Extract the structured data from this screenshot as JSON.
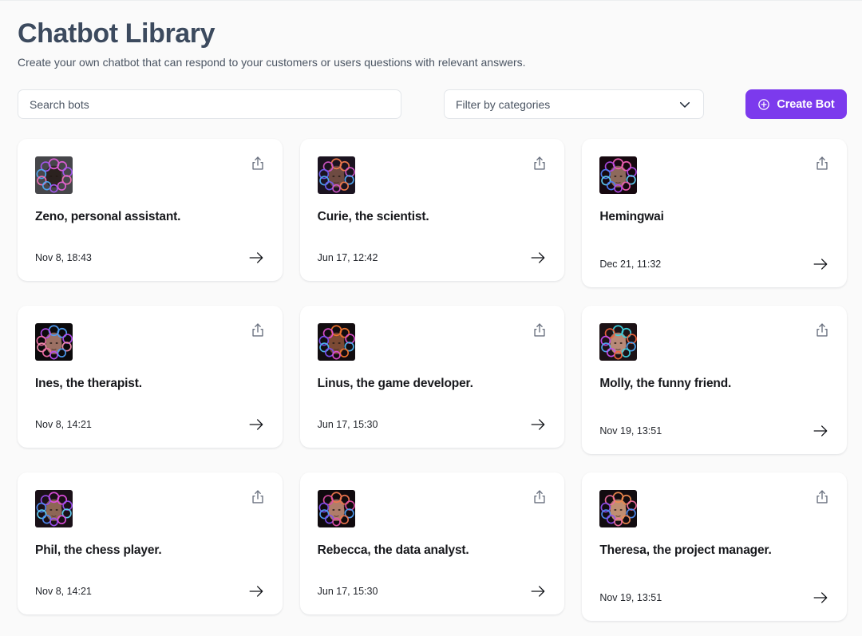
{
  "header": {
    "title": "Chatbot Library",
    "subtitle": "Create your own chatbot that can respond to your customers or users questions with relevant answers."
  },
  "toolbar": {
    "search_placeholder": "Search bots",
    "search_value": "",
    "filter_label": "Filter by categories",
    "filter_icon": "chevron-down-icon",
    "create_button_label": "Create Bot",
    "create_button_icon": "plus-circle-icon",
    "accent_color": "#7c3aed"
  },
  "cards": [
    {
      "title": "Zeno, personal assistant.",
      "date": "Nov 8, 18:43",
      "share_icon": "share-icon",
      "go_icon": "arrow-right-icon",
      "avatar": {
        "name": "bot-avatar",
        "background": "#46464a",
        "face": "#2b2220",
        "ring_colors": [
          "#e05fd8",
          "#a457f0",
          "#4fa9f5",
          "#f06fb5"
        ]
      }
    },
    {
      "title": "Curie, the scientist.",
      "date": "Jun 17, 12:42",
      "share_icon": "share-icon",
      "go_icon": "arrow-right-icon",
      "avatar": {
        "name": "bot-avatar",
        "background": "#1b1320",
        "face": "#6e4b42",
        "ring_colors": [
          "#f07a4d",
          "#d256c8",
          "#6f5df0",
          "#4fa9f5"
        ]
      }
    },
    {
      "title": "Hemingwai",
      "date": "Dec 21, 11:32",
      "share_icon": "share-icon",
      "go_icon": "arrow-right-icon",
      "avatar": {
        "name": "bot-avatar",
        "background": "#16080f",
        "face": "#8e6a5c",
        "ring_colors": [
          "#ef5fb4",
          "#b14ae8",
          "#4f7df5",
          "#5ed0f5"
        ]
      }
    },
    {
      "title": "Ines, the therapist.",
      "date": "Nov 8, 14:21",
      "share_icon": "share-icon",
      "go_icon": "arrow-right-icon",
      "avatar": {
        "name": "bot-avatar",
        "background": "#0c0a0c",
        "face": "#9c7164",
        "ring_colors": [
          "#4f9ef5",
          "#b44ef0",
          "#f06fa5",
          "#f58fb0"
        ]
      }
    },
    {
      "title": "Linus, the game developer.",
      "date": "Jun 17, 15:30",
      "share_icon": "share-icon",
      "go_icon": "arrow-right-icon",
      "avatar": {
        "name": "bot-avatar",
        "background": "#120d10",
        "face": "#7c4a34",
        "ring_colors": [
          "#f0742e",
          "#e04fd0",
          "#7d4ff0",
          "#4fb6f5"
        ]
      }
    },
    {
      "title": "Molly, the funny friend.",
      "date": "Nov 19, 13:51",
      "share_icon": "share-icon",
      "go_icon": "arrow-right-icon",
      "avatar": {
        "name": "bot-avatar",
        "background": "#1c1216",
        "face": "#b98a78",
        "ring_colors": [
          "#3fd4e0",
          "#f0643c",
          "#c74ef0",
          "#4fa9f5"
        ]
      }
    },
    {
      "title": "Phil, the chess player.",
      "date": "Nov 8, 14:21",
      "share_icon": "share-icon",
      "go_icon": "arrow-right-icon",
      "avatar": {
        "name": "bot-avatar",
        "background": "#1a1018",
        "face": "#8d6655",
        "ring_colors": [
          "#e04fe0",
          "#9a4ef0",
          "#4f8df5",
          "#5ed0f5"
        ]
      }
    },
    {
      "title": "Rebecca, the data analyst.",
      "date": "Jun 17, 15:30",
      "share_icon": "share-icon",
      "go_icon": "arrow-right-icon",
      "avatar": {
        "name": "bot-avatar",
        "background": "#100a0e",
        "face": "#b07d6a",
        "ring_colors": [
          "#f0764f",
          "#e04fa8",
          "#7d4ff0",
          "#4f9ef5"
        ]
      }
    },
    {
      "title": "Theresa, the project manager.",
      "date": "Nov 19, 13:51",
      "share_icon": "share-icon",
      "go_icon": "arrow-right-icon",
      "avatar": {
        "name": "bot-avatar",
        "background": "#120c10",
        "face": "#c08f72",
        "ring_colors": [
          "#f08a4f",
          "#ef6f9f",
          "#8d4ff0",
          "#4f8df5"
        ]
      }
    }
  ]
}
